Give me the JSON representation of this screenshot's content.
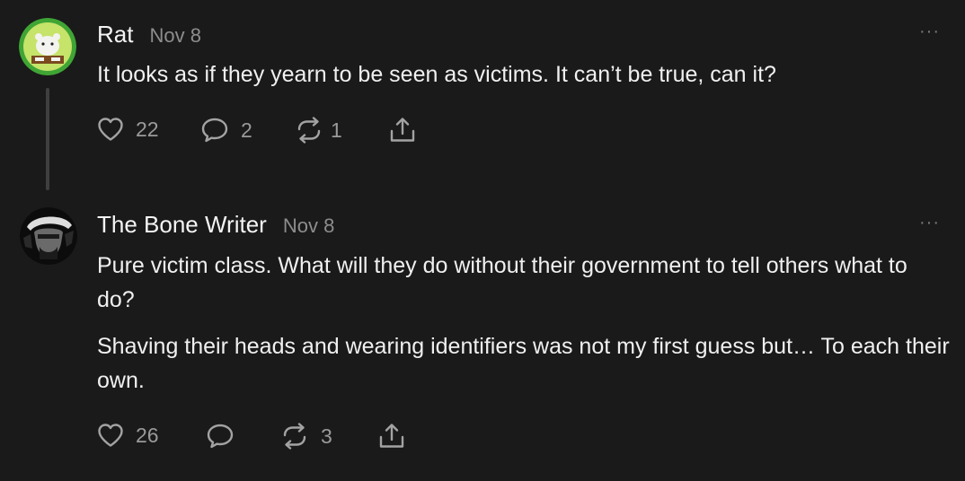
{
  "comments": [
    {
      "author": "Rat",
      "date": "Nov 8",
      "more": "···",
      "paragraphs": [
        "It looks as if they yearn to be seen as victims. It can’t be true, can it?"
      ],
      "likes": "22",
      "replies": "2",
      "restacks": "1"
    },
    {
      "author": "The Bone Writer",
      "date": "Nov 8",
      "more": "···",
      "paragraphs": [
        "Pure victim class. What will they do without their government to tell others what to do?",
        "Shaving their heads and wearing identifiers was not my first guess but… To each their own."
      ],
      "likes": "26",
      "restacks": "3"
    }
  ],
  "icons": {
    "like": "heart-icon",
    "reply": "speech-bubble-icon",
    "restack": "restack-arrows-icon",
    "share": "share-upload-icon"
  },
  "colors": {
    "background": "#1a1a1a",
    "text": "#f2f2f2",
    "muted": "#8d8d8d",
    "avatar_ring": "#3fa535"
  }
}
